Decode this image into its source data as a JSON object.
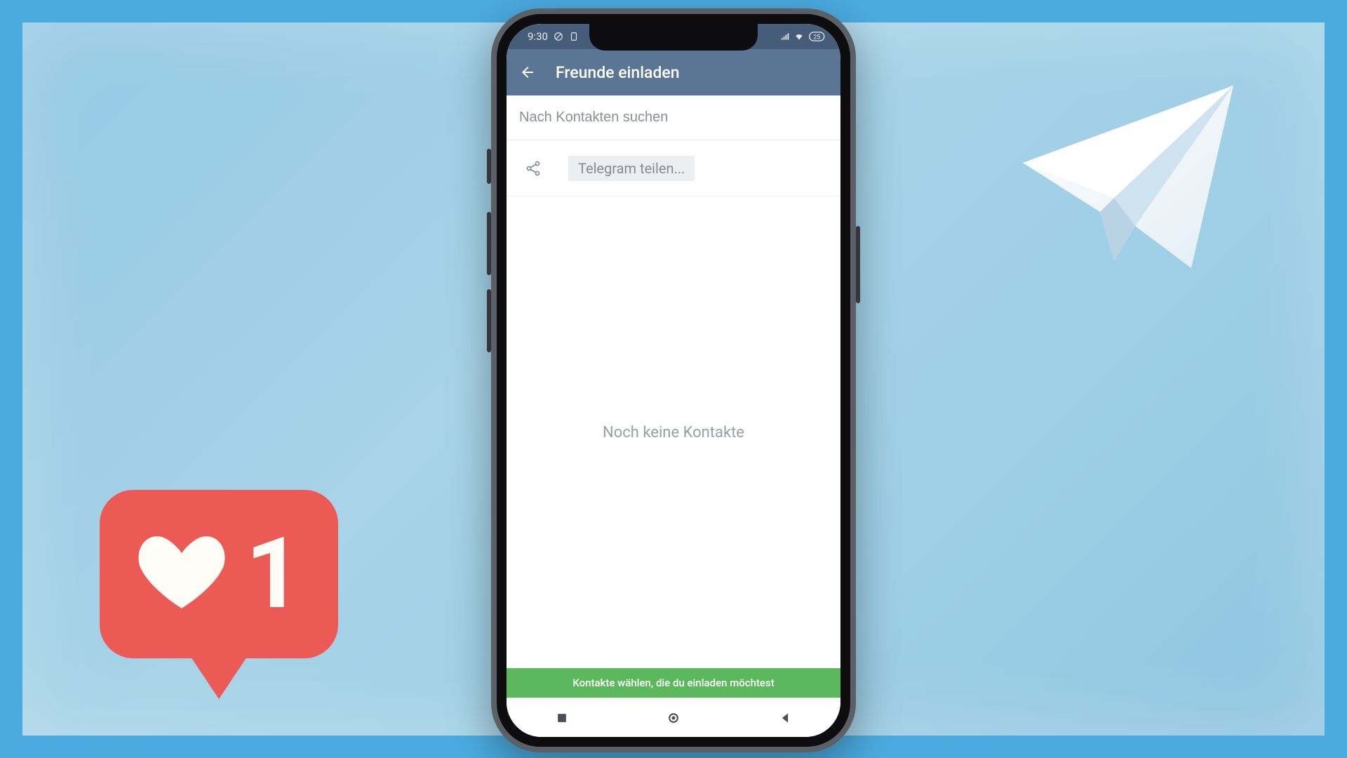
{
  "statusbar": {
    "time": "9:30",
    "battery": "25"
  },
  "appbar": {
    "title": "Freunde einladen"
  },
  "search": {
    "placeholder": "Nach Kontakten suchen",
    "value": ""
  },
  "share": {
    "label": "Telegram teilen..."
  },
  "empty": {
    "text": "Noch keine Kontakte"
  },
  "banner": {
    "text": "Kontakte wählen, die du einladen möchtest"
  },
  "like": {
    "count": "1"
  }
}
